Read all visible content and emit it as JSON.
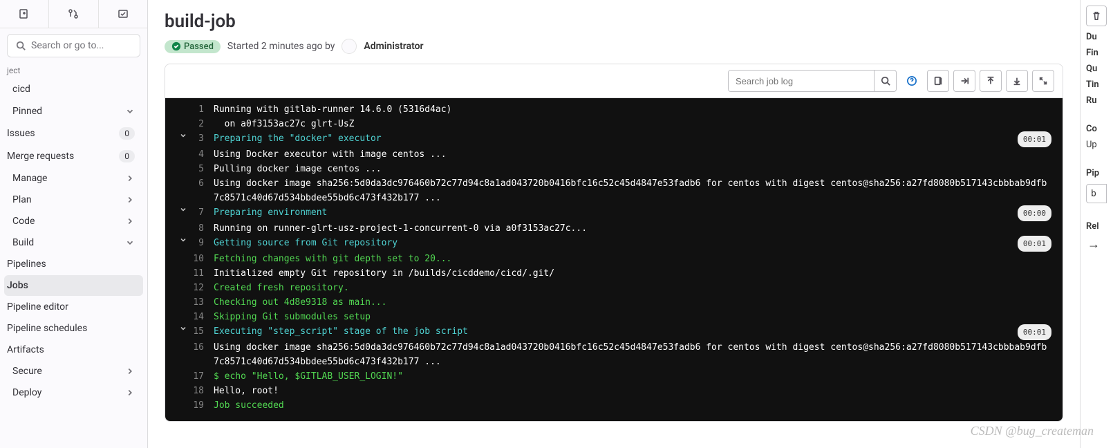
{
  "sidebar": {
    "search_placeholder": "Search or go to...",
    "section_label": "ject",
    "project_name": "cicd",
    "items": [
      {
        "label": "Pinned",
        "type": "expand",
        "open": true,
        "children": [
          {
            "label": "Issues",
            "count": "0"
          },
          {
            "label": "Merge requests",
            "count": "0"
          }
        ]
      },
      {
        "label": "Manage",
        "type": "expand"
      },
      {
        "label": "Plan",
        "type": "expand"
      },
      {
        "label": "Code",
        "type": "expand"
      },
      {
        "label": "Build",
        "type": "expand",
        "open": true,
        "children": [
          {
            "label": "Pipelines"
          },
          {
            "label": "Jobs",
            "active": true
          },
          {
            "label": "Pipeline editor"
          },
          {
            "label": "Pipeline schedules"
          },
          {
            "label": "Artifacts"
          }
        ]
      },
      {
        "label": "Secure",
        "type": "expand"
      },
      {
        "label": "Deploy",
        "type": "expand"
      }
    ]
  },
  "page": {
    "title": "build-job",
    "status": "Passed",
    "started_text": "Started 2 minutes ago by",
    "author": "Administrator",
    "search_placeholder": "Search job log"
  },
  "log": [
    {
      "n": "1",
      "cls": "c-white",
      "text": "Running with gitlab-runner 14.6.0 (5316d4ac)"
    },
    {
      "n": "2",
      "cls": "c-white",
      "text": "  on a0f3153ac27c glrt-UsZ"
    },
    {
      "n": "3",
      "cls": "c-cyan",
      "collapsible": true,
      "time": "00:01",
      "text": "Preparing the \"docker\" executor"
    },
    {
      "n": "4",
      "cls": "c-white",
      "text": "Using Docker executor with image centos ..."
    },
    {
      "n": "5",
      "cls": "c-white",
      "text": "Pulling docker image centos ..."
    },
    {
      "n": "6",
      "cls": "c-white",
      "text": "Using docker image sha256:5d0da3dc976460b72c77d94c8a1ad043720b0416bfc16c52c45d4847e53fadb6 for centos with digest centos@sha256:a27fd8080b517143cbbbab9dfb7c8571c40d67d534bbdee55bd6c473f432b177 ..."
    },
    {
      "n": "7",
      "cls": "c-cyan",
      "collapsible": true,
      "time": "00:00",
      "text": "Preparing environment"
    },
    {
      "n": "8",
      "cls": "c-white",
      "text": "Running on runner-glrt-usz-project-1-concurrent-0 via a0f3153ac27c..."
    },
    {
      "n": "9",
      "cls": "c-cyan",
      "collapsible": true,
      "time": "00:01",
      "text": "Getting source from Git repository"
    },
    {
      "n": "10",
      "cls": "c-lime",
      "text": "Fetching changes with git depth set to 20..."
    },
    {
      "n": "11",
      "cls": "c-white",
      "text": "Initialized empty Git repository in /builds/cicddemo/cicd/.git/"
    },
    {
      "n": "12",
      "cls": "c-lime",
      "text": "Created fresh repository."
    },
    {
      "n": "13",
      "cls": "c-lime",
      "text": "Checking out 4d8e9318 as main..."
    },
    {
      "n": "14",
      "cls": "c-lime",
      "text": "Skipping Git submodules setup"
    },
    {
      "n": "15",
      "cls": "c-cyan",
      "collapsible": true,
      "time": "00:01",
      "text": "Executing \"step_script\" stage of the job script"
    },
    {
      "n": "16",
      "cls": "c-white",
      "text": "Using docker image sha256:5d0da3dc976460b72c77d94c8a1ad043720b0416bfc16c52c45d4847e53fadb6 for centos with digest centos@sha256:a27fd8080b517143cbbbab9dfb7c8571c40d67d534bbdee55bd6c473f432b177 ..."
    },
    {
      "n": "17",
      "cls": "c-lime",
      "text": "$ echo \"Hello, $GITLAB_USER_LOGIN!\""
    },
    {
      "n": "18",
      "cls": "c-white",
      "text": "Hello, root!"
    },
    {
      "n": "19",
      "cls": "c-lime",
      "text": "Job succeeded"
    }
  ],
  "right": {
    "labels": [
      "Du",
      "Fin",
      "Qu",
      "Tin",
      "Ru"
    ],
    "section2": [
      "Co",
      "Up"
    ],
    "section3_label": "Pip",
    "section3_value": "b",
    "section4_label": "Rel"
  },
  "watermark": "CSDN @bug_createman"
}
